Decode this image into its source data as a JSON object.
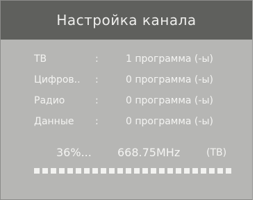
{
  "header": {
    "title": "Настройка канала"
  },
  "rows": [
    {
      "label": "ТВ",
      "sep": ":",
      "value": "1 программа (-ы)"
    },
    {
      "label": "Цифров..",
      "sep": ":",
      "value": "0 программа (-ы)"
    },
    {
      "label": "Радио",
      "sep": ":",
      "value": "0 программа (-ы)"
    },
    {
      "label": "Данные",
      "sep": ":",
      "value": "0 программа (-ы)"
    }
  ],
  "scan": {
    "percent_text": "36%...",
    "frequency": "668.75MHz",
    "type": "(ТВ)"
  },
  "progress": {
    "segments": 24
  }
}
